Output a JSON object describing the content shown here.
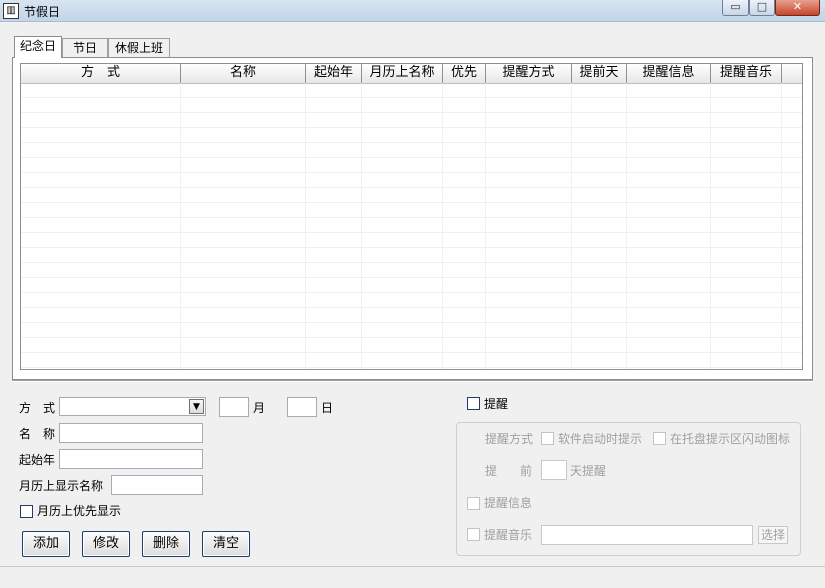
{
  "window": {
    "title": "节假日",
    "icon": "calendar-book-icon",
    "controls": {
      "minimize": "▭",
      "maximize": "□",
      "close": "✕"
    }
  },
  "tabs": [
    {
      "label": "纪念日",
      "active": true
    },
    {
      "label": "节日",
      "active": false
    },
    {
      "label": "休假上班",
      "active": false
    }
  ],
  "grid": {
    "columns": [
      "方　式",
      "名称",
      "起始年",
      "月历上名称",
      "优先",
      "提醒方式",
      "提前天",
      "提醒信息",
      "提醒音乐"
    ],
    "rows": []
  },
  "form": {
    "mode_label": "方　式",
    "mode_value": "",
    "month_label": "月",
    "month_value": "",
    "day_label": "日",
    "day_value": "",
    "name_label": "名　称",
    "name_value": "",
    "start_year_label": "起始年",
    "start_year_value": "",
    "calendar_name_label": "月历上显示名称",
    "calendar_name_value": "",
    "priority_label": "月历上优先显示"
  },
  "buttons": {
    "add": "添加",
    "edit": "修改",
    "delete": "删除",
    "clear": "清空"
  },
  "reminder": {
    "enable_label": "提醒",
    "mode_label": "提醒方式",
    "on_startup_label": "软件启动时提示",
    "tray_flash_label": "在托盘提示区闪动图标",
    "advance_label_1": "提",
    "advance_label_2": "前",
    "advance_value": "",
    "advance_suffix": "天提醒",
    "info_label": "提醒信息",
    "music_label": "提醒音乐",
    "music_value": "",
    "choose_label": "选择"
  },
  "colors": {
    "title_bar": "#c3d5ea",
    "close_button": "#c7452d",
    "disabled_text": "#a0a0a0"
  }
}
